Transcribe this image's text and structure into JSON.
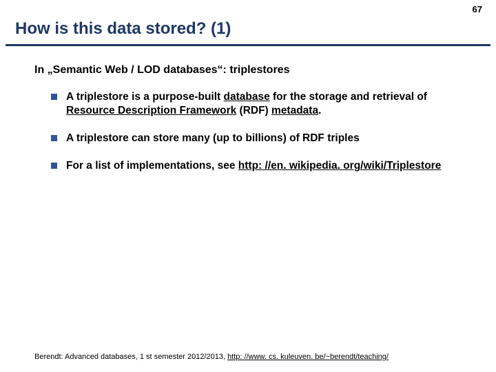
{
  "page_number": "67",
  "title": "How is this data stored? (1)",
  "lead": "In „Semantic Web / LOD databases“: triplestores",
  "bullets": {
    "b0": {
      "t0": "A triplestore is a purpose-built ",
      "u0": "database",
      "t1": " for the storage and retrieval of ",
      "u1": "Resource Description Framework",
      "t2": " (RDF) ",
      "u2": "metadata",
      "t3": "."
    },
    "b1": {
      "t0": "A triplestore can store many (up to billions) of RDF triples"
    },
    "b2": {
      "t0": "For a list of implementations, see ",
      "u0": "http: //en. wikipedia. org/wiki/Triplestore"
    }
  },
  "footer": {
    "text": "Berendt: Advanced databases, 1 st semester 2012/2013, ",
    "link": "http: //www. cs. kuleuven. be/~berendt/teaching/"
  }
}
